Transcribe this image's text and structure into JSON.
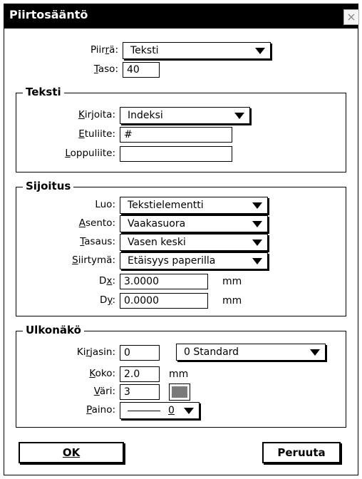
{
  "window": {
    "title": "Piirtosääntö",
    "close_glyph": "×"
  },
  "top": {
    "piirra": {
      "label": "Piirrä:",
      "value": "Teksti"
    },
    "taso": {
      "label": "Taso:",
      "value": "40"
    }
  },
  "teksti": {
    "title": "Teksti",
    "kirjoita": {
      "label": "Kirjoita:",
      "value": "Indeksi"
    },
    "etuliite": {
      "label": "Etuliite:",
      "value": "#"
    },
    "loppuliite": {
      "label": "Loppuliite:",
      "value": ""
    }
  },
  "sijoitus": {
    "title": "Sijoitus",
    "luo": {
      "label": "Luo:",
      "value": "Tekstielementti"
    },
    "asento": {
      "label": "Asento:",
      "value": "Vaakasuora"
    },
    "tasaus": {
      "label": "Tasaus:",
      "value": "Vasen keski"
    },
    "siirtyma": {
      "label": "Siirtymä:",
      "value": "Etäisyys paperilla"
    },
    "dx": {
      "label": "Dx:",
      "value": "3.0000",
      "unit": "mm"
    },
    "dy": {
      "label": "Dy:",
      "value": "0.0000",
      "unit": "mm"
    }
  },
  "ulkonako": {
    "title": "Ulkonäkö",
    "kirjasin": {
      "label": "Kirjasin:",
      "value": "0",
      "font_name": "0 Standard"
    },
    "koko": {
      "label": "Koko:",
      "value": "2.0",
      "unit": "mm"
    },
    "vari": {
      "label": "Väri:",
      "value": "3",
      "swatch_color": "#7a7a7a"
    },
    "paino": {
      "label": "Paino:",
      "value": "0"
    }
  },
  "buttons": {
    "ok": "OK",
    "cancel": "Peruuta"
  },
  "colors": {
    "titlebar": "#000000",
    "background": "#ffffff",
    "swatch": "#7a7a7a"
  }
}
